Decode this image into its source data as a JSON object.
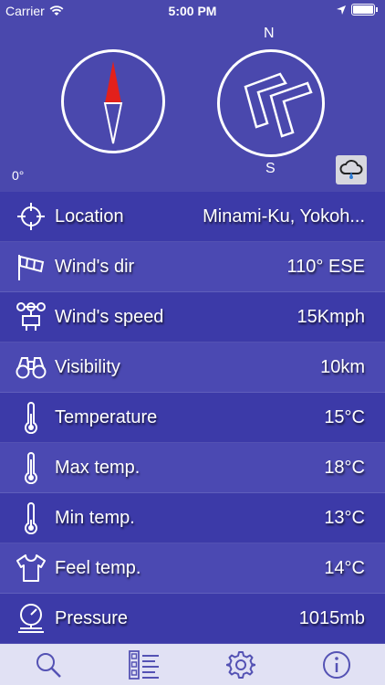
{
  "status_bar": {
    "carrier": "Carrier",
    "time": "5:00 PM"
  },
  "compass": {
    "north": "N",
    "south": "S",
    "heading_label": "0°",
    "heading_deg": 0,
    "wind_direction_deg": 110
  },
  "colors": {
    "background": "#4a48ad",
    "row_dark": "#3c3aa8",
    "row_light": "#4b49b2",
    "needle_red": "#e3201b",
    "tab_bar": "#e1e1f4",
    "tab_icon": "#5452b4"
  },
  "rows": [
    {
      "icon": "crosshair-icon",
      "label": "Location",
      "value": "Minami-Ku, Yokoh..."
    },
    {
      "icon": "windsock-icon",
      "label": "Wind's dir",
      "value": "110° ESE"
    },
    {
      "icon": "anemometer-icon",
      "label": "Wind's speed",
      "value": "15Kmph"
    },
    {
      "icon": "binoculars-icon",
      "label": "Visibility",
      "value": "10km"
    },
    {
      "icon": "thermometer-icon",
      "label": "Temperature",
      "value": "15°C"
    },
    {
      "icon": "thermometer-icon",
      "label": "Max temp.",
      "value": "18°C"
    },
    {
      "icon": "thermometer-icon",
      "label": "Min temp.",
      "value": "13°C"
    },
    {
      "icon": "tshirt-icon",
      "label": "Feel temp.",
      "value": "14°C"
    },
    {
      "icon": "gauge-icon",
      "label": "Pressure",
      "value": "1015mb"
    }
  ],
  "tabs": [
    {
      "icon": "search-icon"
    },
    {
      "icon": "list-icon"
    },
    {
      "icon": "gear-icon"
    },
    {
      "icon": "info-icon"
    }
  ]
}
